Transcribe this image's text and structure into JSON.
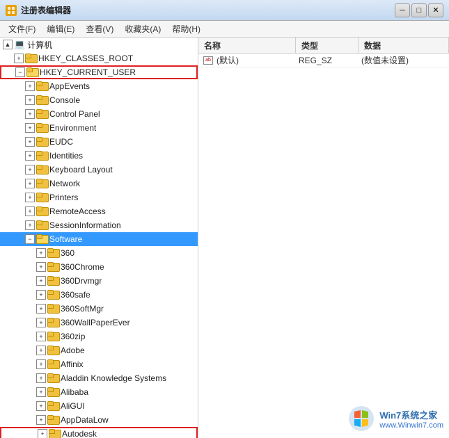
{
  "titleBar": {
    "title": "注册表编辑器",
    "minBtn": "─",
    "maxBtn": "□",
    "closeBtn": "✕"
  },
  "menuBar": {
    "items": [
      "文件(F)",
      "编辑(E)",
      "查看(V)",
      "收藏夹(A)",
      "帮助(H)"
    ]
  },
  "treeNodes": [
    {
      "id": "computer",
      "level": 0,
      "expanded": true,
      "label": "计算机",
      "type": "computer"
    },
    {
      "id": "hkey_classes",
      "level": 1,
      "expanded": false,
      "label": "HKEY_CLASSES_ROOT",
      "type": "folder"
    },
    {
      "id": "hkey_current_user",
      "level": 1,
      "expanded": true,
      "label": "HKEY_CURRENT_USER",
      "type": "folder",
      "highlighted": true
    },
    {
      "id": "appevents",
      "level": 2,
      "expanded": false,
      "label": "AppEvents",
      "type": "folder"
    },
    {
      "id": "console",
      "level": 2,
      "expanded": false,
      "label": "Console",
      "type": "folder"
    },
    {
      "id": "control_panel",
      "level": 2,
      "expanded": false,
      "label": "Control Panel",
      "type": "folder"
    },
    {
      "id": "environment",
      "level": 2,
      "expanded": false,
      "label": "Environment",
      "type": "folder"
    },
    {
      "id": "eudc",
      "level": 2,
      "expanded": false,
      "label": "EUDC",
      "type": "folder"
    },
    {
      "id": "identities",
      "level": 2,
      "expanded": false,
      "label": "Identities",
      "type": "folder"
    },
    {
      "id": "keyboard_layout",
      "level": 2,
      "expanded": false,
      "label": "Keyboard Layout",
      "type": "folder"
    },
    {
      "id": "network",
      "level": 2,
      "expanded": false,
      "label": "Network",
      "type": "folder"
    },
    {
      "id": "printers",
      "level": 2,
      "expanded": false,
      "label": "Printers",
      "type": "folder"
    },
    {
      "id": "remote_access",
      "level": 2,
      "expanded": false,
      "label": "RemoteAccess",
      "type": "folder"
    },
    {
      "id": "session_info",
      "level": 2,
      "expanded": false,
      "label": "SessionInformation",
      "type": "folder"
    },
    {
      "id": "software",
      "level": 2,
      "expanded": true,
      "label": "Software",
      "type": "folder",
      "highlighted": true,
      "selected": true
    },
    {
      "id": "s360",
      "level": 3,
      "expanded": false,
      "label": "360",
      "type": "folder"
    },
    {
      "id": "s360chrome",
      "level": 3,
      "expanded": false,
      "label": "360Chrome",
      "type": "folder"
    },
    {
      "id": "s360drvmgr",
      "level": 3,
      "expanded": false,
      "label": "360Drvmgr",
      "type": "folder"
    },
    {
      "id": "s360safe",
      "level": 3,
      "expanded": false,
      "label": "360safe",
      "type": "folder"
    },
    {
      "id": "s360softmgr",
      "level": 3,
      "expanded": false,
      "label": "360SoftMgr",
      "type": "folder"
    },
    {
      "id": "s360wallpaper",
      "level": 3,
      "expanded": false,
      "label": "360WallPaperEver",
      "type": "folder"
    },
    {
      "id": "s360zip",
      "level": 3,
      "expanded": false,
      "label": "360zip",
      "type": "folder"
    },
    {
      "id": "adobe",
      "level": 3,
      "expanded": false,
      "label": "Adobe",
      "type": "folder"
    },
    {
      "id": "affinix",
      "level": 3,
      "expanded": false,
      "label": "Affinix",
      "type": "folder"
    },
    {
      "id": "aladdin",
      "level": 3,
      "expanded": false,
      "label": "Aladdin Knowledge Systems",
      "type": "folder"
    },
    {
      "id": "alibaba",
      "level": 3,
      "expanded": false,
      "label": "Alibaba",
      "type": "folder"
    },
    {
      "id": "aligui",
      "level": 3,
      "expanded": false,
      "label": "AliGUI",
      "type": "folder"
    },
    {
      "id": "appdatalow",
      "level": 3,
      "expanded": false,
      "label": "AppDataLow",
      "type": "folder"
    },
    {
      "id": "autodesk",
      "level": 3,
      "expanded": false,
      "label": "Autodesk",
      "type": "folder",
      "highlighted": true
    }
  ],
  "rightPane": {
    "columns": [
      "名称",
      "类型",
      "数据"
    ],
    "rows": [
      {
        "name": "(默认)",
        "type": "REG_SZ",
        "data": "(数值未设置)"
      }
    ]
  },
  "watermark": {
    "line1": "Win7系统之家",
    "url": "www.Winwin7.com"
  }
}
